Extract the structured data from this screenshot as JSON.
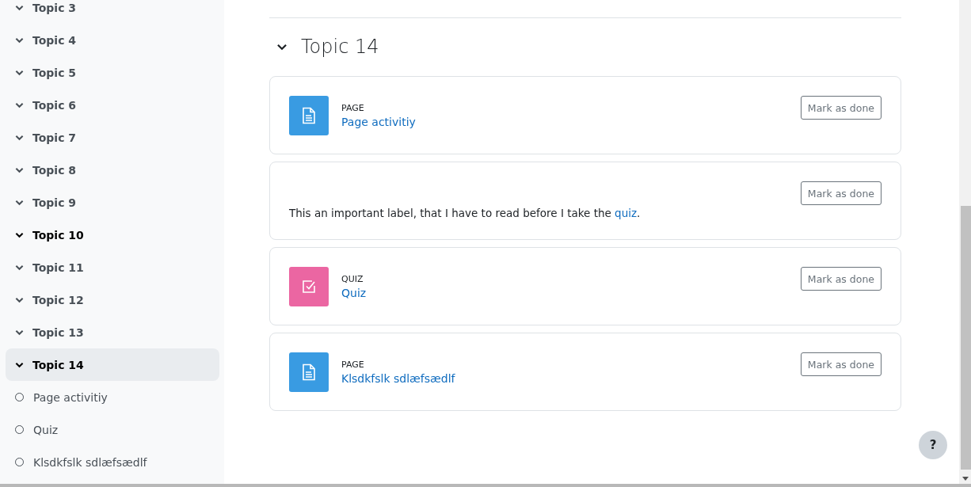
{
  "sidebar": {
    "sections": [
      {
        "label": "Topic 3",
        "expanded": true,
        "selected": false,
        "hovered": false
      },
      {
        "label": "Topic 4",
        "expanded": true,
        "selected": false,
        "hovered": false
      },
      {
        "label": "Topic 5",
        "expanded": true,
        "selected": false,
        "hovered": false
      },
      {
        "label": "Topic 6",
        "expanded": true,
        "selected": false,
        "hovered": false
      },
      {
        "label": "Topic 7",
        "expanded": true,
        "selected": false,
        "hovered": false
      },
      {
        "label": "Topic 8",
        "expanded": true,
        "selected": false,
        "hovered": false
      },
      {
        "label": "Topic 9",
        "expanded": true,
        "selected": false,
        "hovered": false
      },
      {
        "label": "Topic 10",
        "expanded": true,
        "selected": false,
        "hovered": true
      },
      {
        "label": "Topic 11",
        "expanded": true,
        "selected": false,
        "hovered": false
      },
      {
        "label": "Topic 12",
        "expanded": true,
        "selected": false,
        "hovered": false
      },
      {
        "label": "Topic 13",
        "expanded": true,
        "selected": false,
        "hovered": false
      },
      {
        "label": "Topic 14",
        "expanded": true,
        "selected": true,
        "hovered": false,
        "children": [
          {
            "label": "Page activitiy",
            "completed": false
          },
          {
            "label": "Quiz",
            "completed": false
          },
          {
            "label": "Klsdkfslk sdlæfsædlf",
            "completed": false
          }
        ]
      }
    ]
  },
  "section": {
    "title": "Topic 14",
    "expanded": true,
    "activities": [
      {
        "kind": "page",
        "type_label": "PAGE",
        "name": "Page activitiy",
        "button": "Mark as done"
      },
      {
        "kind": "label",
        "text_before": "This an important label, that I have to read before I take the ",
        "link": "quiz",
        "text_after": ".",
        "button": "Mark as done"
      },
      {
        "kind": "quiz",
        "type_label": "QUIZ",
        "name": "Quiz",
        "button": "Mark as done"
      },
      {
        "kind": "page",
        "type_label": "PAGE",
        "name": "Klsdkfslk sdlæfsædlf",
        "button": "Mark as done"
      }
    ]
  },
  "help_button": "?"
}
